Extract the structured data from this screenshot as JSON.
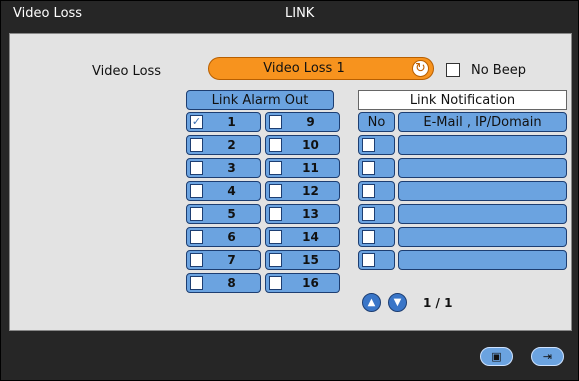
{
  "window": {
    "title_left": "Video Loss",
    "title_center": "LINK"
  },
  "video_loss": {
    "label": "Video Loss",
    "value": "Video Loss 1",
    "no_beep_label": "No Beep",
    "no_beep_checked": false
  },
  "alarm_out": {
    "header": "Link Alarm Out",
    "items": [
      {
        "label": "1",
        "checked": true
      },
      {
        "label": "2",
        "checked": false
      },
      {
        "label": "3",
        "checked": false
      },
      {
        "label": "4",
        "checked": false
      },
      {
        "label": "5",
        "checked": false
      },
      {
        "label": "6",
        "checked": false
      },
      {
        "label": "7",
        "checked": false
      },
      {
        "label": "8",
        "checked": false
      },
      {
        "label": "9",
        "checked": false
      },
      {
        "label": "10",
        "checked": false
      },
      {
        "label": "11",
        "checked": false
      },
      {
        "label": "12",
        "checked": false
      },
      {
        "label": "13",
        "checked": false
      },
      {
        "label": "14",
        "checked": false
      },
      {
        "label": "15",
        "checked": false
      },
      {
        "label": "16",
        "checked": false
      }
    ]
  },
  "notification": {
    "header": "Link Notification",
    "col_no": "No",
    "col_email": "E-Mail , IP/Domain",
    "rows": [
      {
        "email": ""
      },
      {
        "email": ""
      },
      {
        "email": ""
      },
      {
        "email": ""
      },
      {
        "email": ""
      },
      {
        "email": ""
      }
    ],
    "page": "1 / 1"
  },
  "icons": {
    "refresh": "refresh-icon",
    "up": "chevron-up-icon",
    "down": "chevron-down-icon",
    "save": "save-icon",
    "exit": "exit-icon"
  },
  "colors": {
    "accent_orange": "#f7931e",
    "cell_blue": "#6ba3e0",
    "frame_dark": "#262626",
    "panel_gray": "#e3e3e3"
  }
}
